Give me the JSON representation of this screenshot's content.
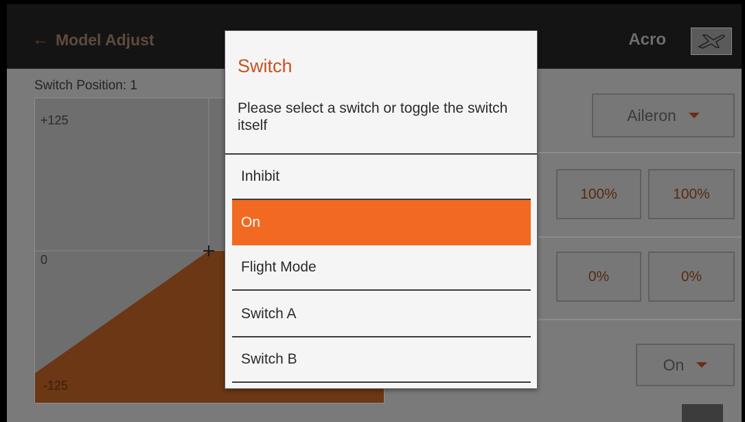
{
  "header": {
    "back_label": "Model Adjust",
    "model_type": "Acro",
    "model_icon": "airplane-icon"
  },
  "left_panel": {
    "switch_position": "Switch Position: 1",
    "graph": {
      "top_label": "+125",
      "mid_label": "0",
      "bottom_label": "-125",
      "min": -125,
      "max": 125
    }
  },
  "right_panel": {
    "channel_dropdown": "Aileron",
    "rate_values": [
      "100%",
      "100%"
    ],
    "expo_values": [
      "0%",
      "0%"
    ],
    "switch_dropdown": "On"
  },
  "dialog": {
    "title": "Switch",
    "description": "Please select a switch or toggle the switch itself",
    "options": [
      "Inhibit",
      "On",
      "Flight Mode",
      "Switch A",
      "Switch B"
    ],
    "selected": "On"
  },
  "colors": {
    "accent": "#f26a22",
    "title_accent": "#c4551d",
    "graph_fill": "#6b3714"
  }
}
